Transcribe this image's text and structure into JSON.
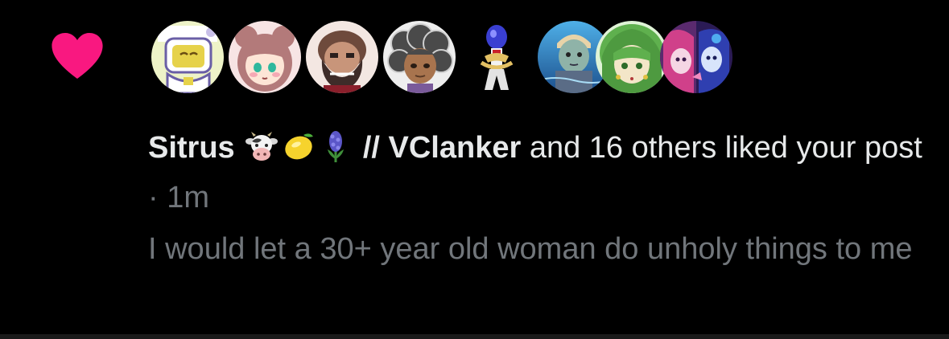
{
  "notification": {
    "type_icon": "heart-icon",
    "like_color": "#f91880",
    "avatars": [
      {
        "name": "avatar-robot",
        "bg": "#d9e59a"
      },
      {
        "name": "avatar-bear-girl",
        "bg": "#f0d6d6"
      },
      {
        "name": "avatar-bearded-man",
        "bg": "#6b4638"
      },
      {
        "name": "avatar-curly-hair",
        "bg": "#e6e6e6"
      },
      {
        "name": "avatar-figure",
        "bg": "#000000"
      },
      {
        "name": "avatar-swimming-boy",
        "bg": "#2e7ab0"
      },
      {
        "name": "avatar-green-hair",
        "bg": "#8ccf74"
      },
      {
        "name": "avatar-anime-duo",
        "bg": "#5a3fa8"
      }
    ],
    "actor_name": "Sitrus",
    "actor_emojis": [
      "cow-face-icon",
      "lemon-icon",
      "hyacinth-icon"
    ],
    "actor_name_suffix": "// VClanker",
    "action_text": "and 16 others liked your post",
    "separator": "·",
    "timestamp": "1m",
    "post_preview": "I would let a 30+ year old woman do unholy things to me"
  }
}
